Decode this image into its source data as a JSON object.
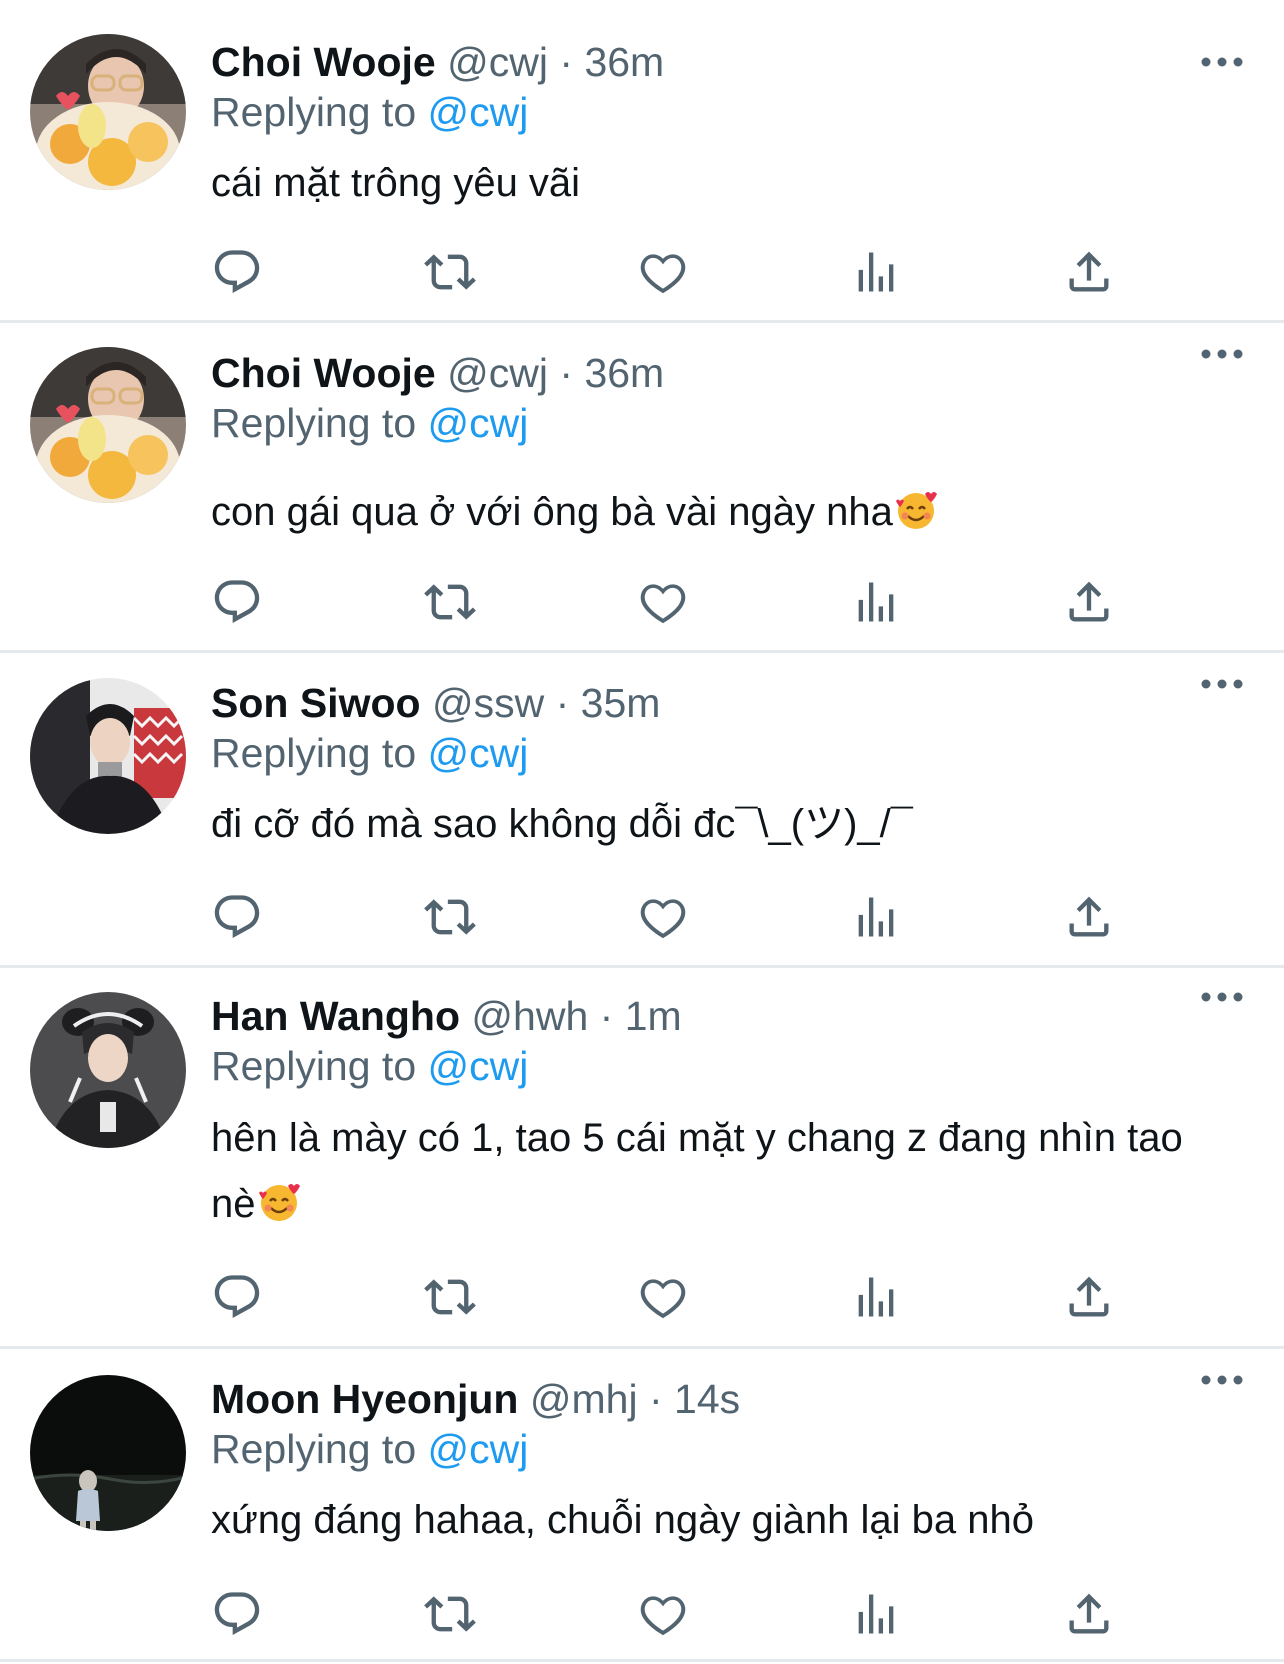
{
  "tweets": [
    {
      "name": "Choi Wooje",
      "handle": "@cwj",
      "sep": "·",
      "time": "36m",
      "replying_prefix": "Replying to",
      "replying_to": "@cwj",
      "text": "cái mặt trông yêu vãi",
      "emoji": ""
    },
    {
      "name": "Choi Wooje",
      "handle": "@cwj",
      "sep": "·",
      "time": "36m",
      "replying_prefix": "Replying to",
      "replying_to": "@cwj",
      "text": "con gái qua ở với ông bà vài ngày nha",
      "emoji": "smiling-face-with-hearts"
    },
    {
      "name": "Son Siwoo",
      "handle": "@ssw",
      "sep": "·",
      "time": "35m",
      "replying_prefix": "Replying to",
      "replying_to": "@cwj",
      "text": "đi cỡ đó mà sao không dỗi đc¯\\_(ツ)_/¯",
      "emoji": ""
    },
    {
      "name": "Han Wangho",
      "handle": "@hwh",
      "sep": "·",
      "time": "1m",
      "replying_prefix": "Replying to",
      "replying_to": "@cwj",
      "text": "hên là mày có 1, tao 5 cái mặt y chang z đang nhìn tao nè",
      "emoji": "smiling-face-with-hearts"
    },
    {
      "name": "Moon Hyeonjun",
      "handle": "@mhj",
      "sep": "·",
      "time": "14s",
      "replying_prefix": "Replying to",
      "replying_to": "@cwj",
      "text": "xứng đáng hahaa, chuỗi ngày giành lại ba nhỏ",
      "emoji": ""
    }
  ],
  "icons": {
    "reply": "reply-icon",
    "retweet": "retweet-icon",
    "like": "heart-icon",
    "views": "views-icon",
    "share": "share-icon",
    "more": "more-icon"
  },
  "colors": {
    "text": "#0f1419",
    "secondary": "#536471",
    "link": "#1d9bf0",
    "divider": "#e6e9eb"
  }
}
